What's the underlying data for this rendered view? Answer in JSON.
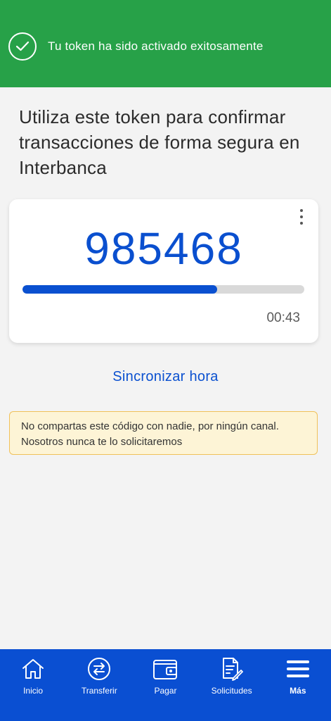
{
  "banner": {
    "message": "Tu token ha sido activado exitosamente",
    "icon": "check-circle-icon",
    "color": "#27a148"
  },
  "headline": "Utiliza este token para confirmar transacciones de forma segura en Interbanca",
  "token": {
    "code": "985468",
    "progress": 0.69,
    "timer": "00:43",
    "menu_icon": "more-vertical-icon",
    "accent": "#0a50d0"
  },
  "sync_link": "Sincronizar hora",
  "warning": "No compartas este código con nadie, por ningún canal.  Nosotros nunca te lo solicitaremos",
  "nav": {
    "background": "#0a4fd2",
    "items": [
      {
        "label": "Inicio",
        "icon": "home-icon"
      },
      {
        "label": "Transferir",
        "icon": "transfer-icon"
      },
      {
        "label": "Pagar",
        "icon": "wallet-icon"
      },
      {
        "label": "Solicitudes",
        "icon": "document-edit-icon"
      },
      {
        "label": "Más",
        "icon": "menu-icon"
      }
    ]
  }
}
